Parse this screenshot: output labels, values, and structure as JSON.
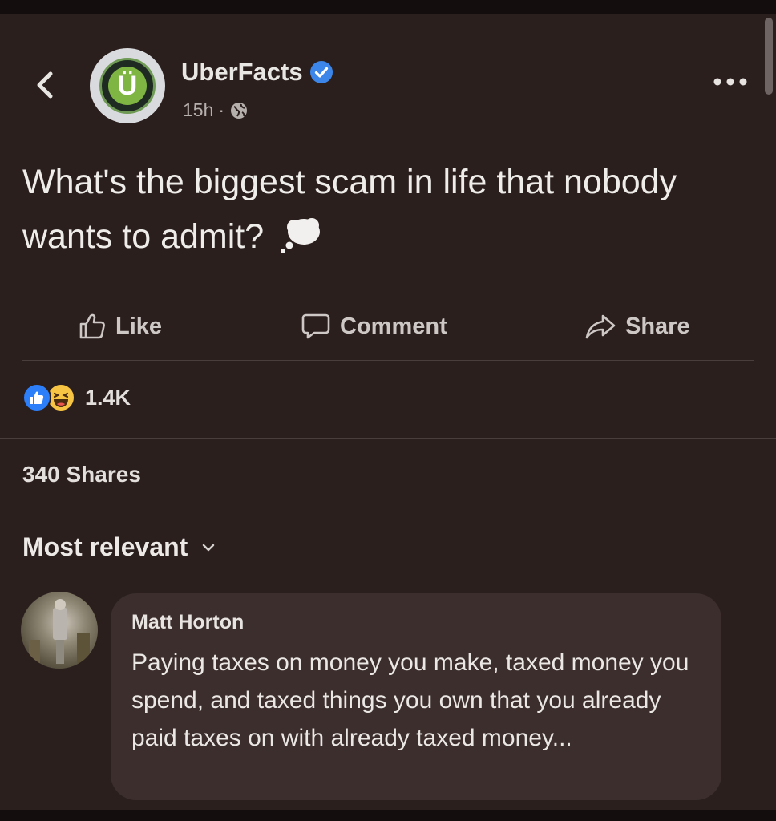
{
  "post": {
    "author": "UberFacts",
    "avatar_letter": "Ü",
    "time": "15h",
    "dot": "·",
    "text": "What's the biggest scam in life that nobody wants to admit?"
  },
  "actions": {
    "like": "Like",
    "comment": "Comment",
    "share": "Share"
  },
  "reactions": {
    "count": "1.4K"
  },
  "shares_text": "340 Shares",
  "sort": {
    "label": "Most relevant"
  },
  "comment": {
    "author": "Matt Horton",
    "text": "Paying taxes on money you make, taxed money you spend, and taxed things you own that you already paid taxes on with already taxed money..."
  },
  "colors": {
    "background": "#2b1f1e",
    "verified": "#3b86e8",
    "like_reaction": "#2d7ff9",
    "haha_reaction": "#f7c443",
    "avatar_green": "#7fb643"
  }
}
